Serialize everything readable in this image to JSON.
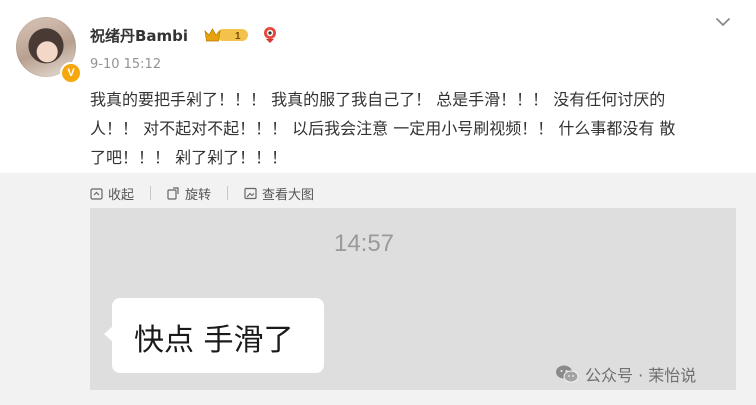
{
  "post": {
    "username": "祝绪丹Bambi",
    "vip_level": "1",
    "verified_badge": "V",
    "time": "9-10 15:12",
    "text_lines": [
      "我真的要把手剁了！！！ 我真的服了我自己了！ 总是手滑！！！ 没有任何讨厌的",
      "人！！ 对不起对不起！！！ 以后我会注意 一定用小号刷视频！！ 什么事都没有 散",
      "了吧！！！ 剁了剁了！！！"
    ]
  },
  "actions": {
    "collapse": "收起",
    "repost": "旋转",
    "view_large": "查看大图"
  },
  "image": {
    "chat_time": "14:57",
    "message": "快点 手滑了"
  },
  "watermark": {
    "text": "公众号 · 茉怡说"
  },
  "icons": {
    "more": "chevron-down-icon",
    "collapse": "collapse-icon",
    "rotate": "rotate-icon",
    "view_large": "image-icon",
    "wechat": "wechat-icon"
  },
  "colors": {
    "verified_badge": "#f6a70d",
    "vip_crown": "#e6a20f"
  }
}
